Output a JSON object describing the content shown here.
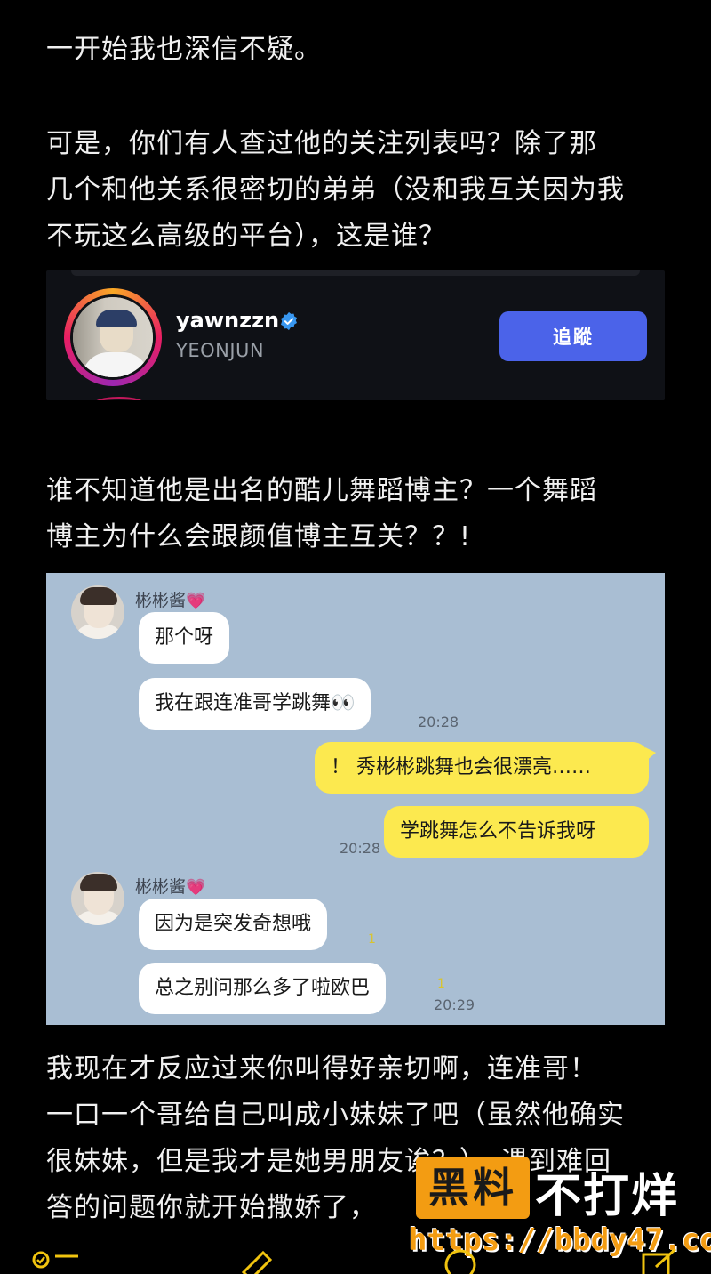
{
  "paragraphs": {
    "p1": "一开始我也深信不疑。",
    "p2": "可是，你们有人查过他的关注列表吗？除了那\n几个和他关系很密切的弟弟（没和我互关因为我\n不玩这么高级的平台），这是谁？",
    "p3": "谁不知道他是出名的酷儿舞蹈博主？一个舞蹈\n博主为什么会跟颜值博主互关？？!",
    "p4": "我现在才反应过来你叫得好亲切啊，连准哥！\n一口一个哥给自己叫成小妹妹了吧（虽然他确实\n很妹妹，但是我才是她男朋友诶？），遇到难回\n答的问题你就开始撒娇了，"
  },
  "instagram_card": {
    "username": "yawnzzn",
    "full_name": "YEONJUN",
    "follow_button": "追蹤",
    "verified_icon": "verified-badge-icon",
    "colors": {
      "button": "#4b63e9",
      "background": "#0f1116"
    }
  },
  "chat": {
    "background_color": "#a9bed3",
    "sender_name": "彬彬酱",
    "sender_heart": "💗",
    "messages": [
      {
        "from": "them",
        "text": "那个呀"
      },
      {
        "from": "them",
        "text": "我在跟连准哥学跳舞👀",
        "time": "20:28"
      },
      {
        "from": "me",
        "text": "！ 秀彬彬跳舞也会很漂亮……"
      },
      {
        "from": "me",
        "text": "学跳舞怎么不告诉我呀",
        "time": "20:28"
      },
      {
        "from": "them",
        "text": "因为是突发奇想哦",
        "read": "1"
      },
      {
        "from": "them",
        "text": "总之别问那么多了啦欧巴",
        "read": "1",
        "time": "20:29"
      }
    ]
  },
  "watermark": {
    "box_text": "黑料",
    "text": "不打烊",
    "url": "https://bbdy47.com"
  },
  "toolbar_icons": [
    "checklist-icon",
    "edit-icon",
    "location-icon",
    "compose-icon"
  ]
}
